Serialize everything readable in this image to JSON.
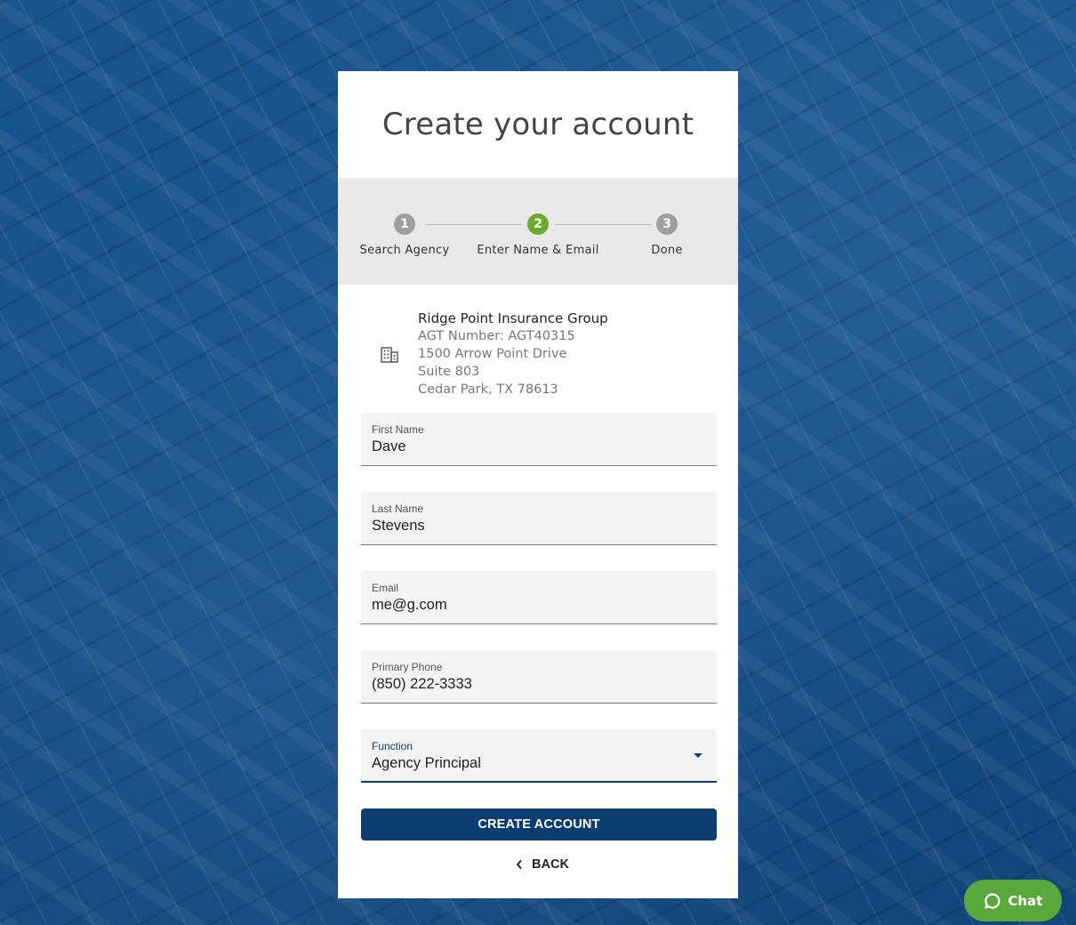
{
  "page": {
    "title": "Create your account"
  },
  "stepper": {
    "steps": [
      {
        "number": "1",
        "label": "Search Agency",
        "color": "#9e9e9e"
      },
      {
        "number": "2",
        "label": "Enter Name & Email",
        "color": "#6aab2e"
      },
      {
        "number": "3",
        "label": "Done",
        "color": "#9e9e9e"
      }
    ]
  },
  "agency": {
    "name": "Ridge Point Insurance Group",
    "agt_number": "AGT Number: AGT40315",
    "address1": "1500 Arrow Point Drive",
    "address2": "Suite 803",
    "city_state_zip": "Cedar Park, TX 78613",
    "icon": "building-icon"
  },
  "form": {
    "first_name": {
      "label": "First Name",
      "value": "Dave"
    },
    "last_name": {
      "label": "Last Name",
      "value": "Stevens"
    },
    "email": {
      "label": "Email",
      "value": "me@g.com"
    },
    "phone": {
      "label": "Primary Phone",
      "value": "(850) 222-3333"
    },
    "function": {
      "label": "Function",
      "value": "Agency Principal"
    }
  },
  "actions": {
    "create_label": "CREATE ACCOUNT",
    "back_label": "BACK"
  },
  "chat": {
    "label": "Chat"
  },
  "colors": {
    "primary": "#0b3d70",
    "active_step": "#6aab2e",
    "chat": "#59a83b"
  }
}
